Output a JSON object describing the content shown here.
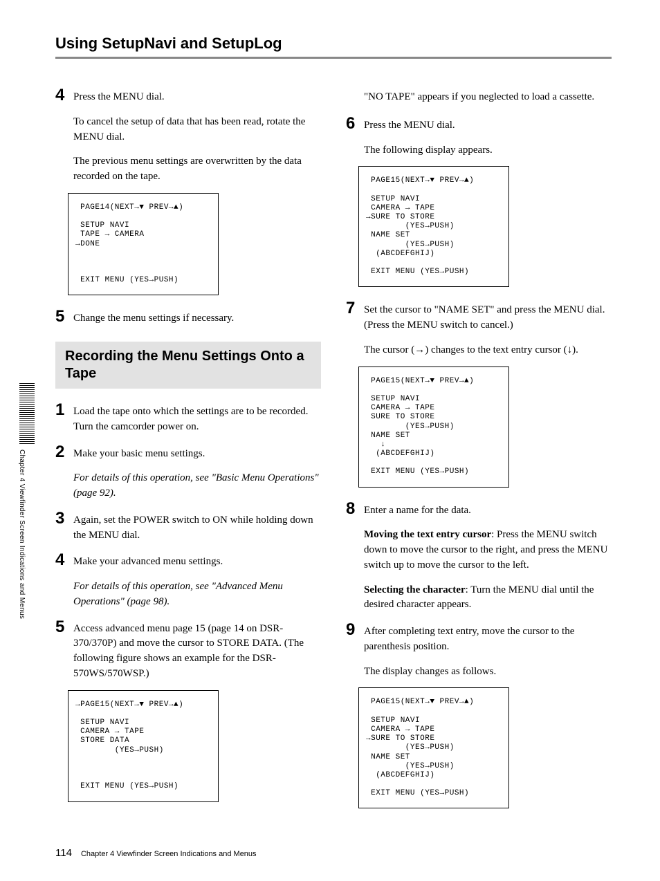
{
  "title": "Using SetupNavi and SetupLog",
  "left": {
    "step4": {
      "num": "4",
      "line1": "Press the MENU dial.",
      "line2": "To cancel the setup of data that has been read, rotate the MENU dial.",
      "line3": "The previous menu settings are overwritten by the data recorded on the tape."
    },
    "screen1": " PAGE14(NEXT→▼ PREV→▲)\n\n SETUP NAVI\n TAPE → CAMERA\n→DONE\n\n\n\n EXIT MENU (YES→PUSH)",
    "step5": {
      "num": "5",
      "line1": "Change the menu settings if necessary."
    },
    "section_heading": "Recording the Menu Settings Onto a Tape",
    "r1": {
      "num": "1",
      "line1": "Load the tape onto which the settings are to be recorded.  Turn the camcorder power on."
    },
    "r2": {
      "num": "2",
      "line1": "Make your basic menu settings.",
      "line2": "For details of this operation, see \"Basic Menu Operations\" (page 92)."
    },
    "r3": {
      "num": "3",
      "line1": "Again, set the POWER switch to ON while holding down the MENU dial."
    },
    "r4": {
      "num": "4",
      "line1": "Make your advanced menu settings.",
      "line2": "For details of this operation, see \"Advanced Menu Operations\" (page 98)."
    },
    "r5": {
      "num": "5",
      "line1": "Access advanced menu page 15 (page 14 on DSR-370/370P) and move the cursor to STORE DATA. (The following figure shows an example for the DSR-570WS/570WSP.)"
    },
    "screen2": "→PAGE15(NEXT→▼ PREV→▲)\n\n SETUP NAVI\n CAMERA → TAPE\n STORE DATA\n        (YES→PUSH)\n\n\n\n EXIT MENU (YES→PUSH)"
  },
  "right": {
    "cont": "\"NO TAPE\" appears if you neglected to load a cassette.",
    "r6": {
      "num": "6",
      "line1": "Press the MENU dial.",
      "line2": "The following display appears."
    },
    "screen3": " PAGE15(NEXT→▼ PREV→▲)\n\n SETUP NAVI\n CAMERA → TAPE\n→SURE TO STORE\n        (YES→PUSH)\n NAME SET\n        (YES→PUSH)\n  (ABCDEFGHIJ)\n\n EXIT MENU (YES→PUSH)",
    "r7": {
      "num": "7",
      "line1": "Set the cursor to \"NAME SET\" and press the MENU dial. (Press the MENU switch to cancel.)",
      "line2": "The cursor (→) changes to the text entry cursor (↓)."
    },
    "screen4": " PAGE15(NEXT→▼ PREV→▲)\n\n SETUP NAVI\n CAMERA → TAPE\n SURE TO STORE\n        (YES→PUSH)\n NAME SET\n   ↓\n  (ABCDEFGHIJ)\n\n EXIT MENU (YES→PUSH)",
    "r8": {
      "num": "8",
      "line1": "Enter a name for the data.",
      "move_label": "Moving the text entry cursor",
      "move_body": ":  Press the MENU switch down to move the cursor to the right, and press the MENU switch up to move the cursor to the left.",
      "sel_label": "Selecting the character",
      "sel_body": ":  Turn the MENU dial until the desired character appears."
    },
    "r9": {
      "num": "9",
      "line1": "After completing text entry, move the cursor to the parenthesis position.",
      "line2": "The display changes as follows."
    },
    "screen5": " PAGE15(NEXT→▼ PREV→▲)\n\n SETUP NAVI\n CAMERA → TAPE\n→SURE TO STORE\n        (YES→PUSH)\n NAME SET\n        (YES→PUSH)\n  (ABCDEFGHIJ)\n\n EXIT MENU (YES→PUSH)"
  },
  "sidebar": "Chapter 4 Viewfinder Screen Indications and Menus",
  "footer": {
    "page": "114",
    "text": "Chapter 4   Viewfinder Screen Indications and Menus"
  }
}
